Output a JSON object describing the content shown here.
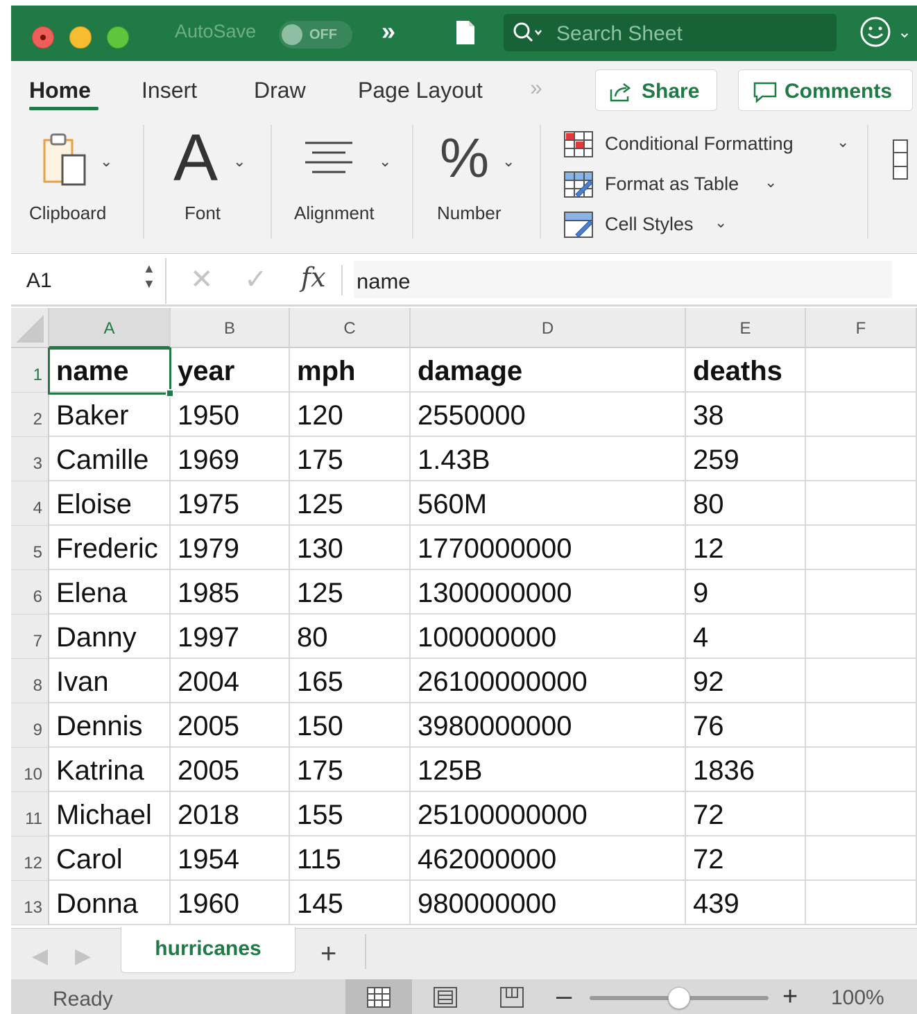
{
  "titlebar": {
    "autosave_label": "AutoSave",
    "autosave_state": "OFF",
    "search_placeholder": "Search Sheet"
  },
  "ribbon_tabs": [
    "Home",
    "Insert",
    "Draw",
    "Page Layout"
  ],
  "ribbon_buttons": {
    "share": "Share",
    "comments": "Comments"
  },
  "ribbon_groups": {
    "clipboard": "Clipboard",
    "font": "Font",
    "alignment": "Alignment",
    "number": "Number"
  },
  "styles": {
    "conditional_formatting": "Conditional Formatting",
    "format_as_table": "Format as Table",
    "cell_styles": "Cell Styles"
  },
  "formula_bar": {
    "name_box": "A1",
    "formula": "name"
  },
  "columns": [
    "A",
    "B",
    "C",
    "D",
    "E",
    "F"
  ],
  "rows": [
    [
      "name",
      "year",
      "mph",
      "damage",
      "deaths"
    ],
    [
      "Baker",
      "1950",
      "120",
      "2550000",
      "38"
    ],
    [
      "Camille",
      "1969",
      "175",
      "1.43B",
      "259"
    ],
    [
      "Eloise",
      "1975",
      "125",
      "560M",
      "80"
    ],
    [
      "Frederic",
      "1979",
      "130",
      "1770000000",
      "12"
    ],
    [
      "Elena",
      "1985",
      "125",
      "1300000000",
      "9"
    ],
    [
      "Danny",
      "1997",
      "80",
      "100000000",
      "4"
    ],
    [
      "Ivan",
      "2004",
      "165",
      "26100000000",
      "92"
    ],
    [
      "Dennis",
      "2005",
      "150",
      "3980000000",
      "76"
    ],
    [
      "Katrina",
      "2005",
      "175",
      "125B",
      "1836"
    ],
    [
      "Michael",
      "2018",
      "155",
      "25100000000",
      "72"
    ],
    [
      "Carol",
      "1954",
      "115",
      "462000000",
      "72"
    ],
    [
      "Donna",
      "1960",
      "145",
      "980000000",
      "439"
    ]
  ],
  "sheet_tabs": [
    "hurricanes"
  ],
  "status": {
    "text": "Ready",
    "zoom": "100%",
    "zoom_fraction": 0.5
  },
  "colors": {
    "accent": "#1f7a45",
    "titlebar": "#1f7a45",
    "search_bg": "#176337"
  },
  "icons": [
    "close-window-icon",
    "minimize-window-icon",
    "zoom-window-icon",
    "document-icon",
    "search-icon",
    "smiley-icon",
    "share-icon",
    "comment-icon",
    "paste-icon",
    "font-icon",
    "align-icon",
    "percent-icon",
    "conditional-formatting-icon",
    "format-table-icon",
    "cell-styles-icon",
    "cancel-icon",
    "confirm-icon",
    "fx-icon",
    "normal-view-icon",
    "page-layout-view-icon",
    "page-break-view-icon"
  ]
}
